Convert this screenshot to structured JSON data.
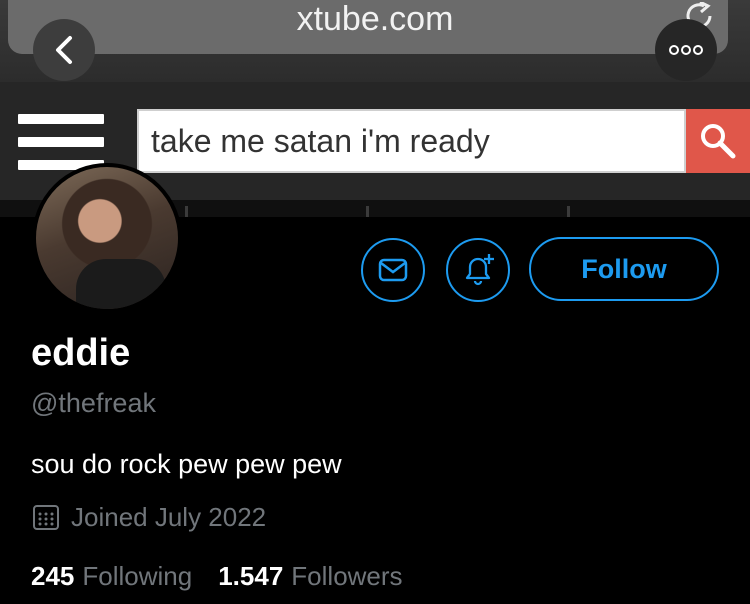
{
  "browser": {
    "url": "xtube.com",
    "back_icon": "chevron-left-icon",
    "more_icon": "ellipsis-icon",
    "reload_icon": "reload-icon"
  },
  "site": {
    "menu_icon": "hamburger-icon",
    "search_query": "take me satan i'm ready",
    "search_icon": "magnifier-icon",
    "search_button_color": "#e0574a"
  },
  "profile": {
    "display_name": "eddie",
    "handle": "@thefreak",
    "bio": "sou do rock pew pew pew",
    "joined": "Joined July 2022",
    "following_count": "245",
    "following_label": "Following",
    "followers_count": "1.547",
    "followers_label": "Followers",
    "follow_label": "Follow",
    "accent_color": "#1d9bf0",
    "message_icon": "envelope-icon",
    "notify_icon": "bell-plus-icon",
    "calendar_icon": "calendar-icon"
  }
}
